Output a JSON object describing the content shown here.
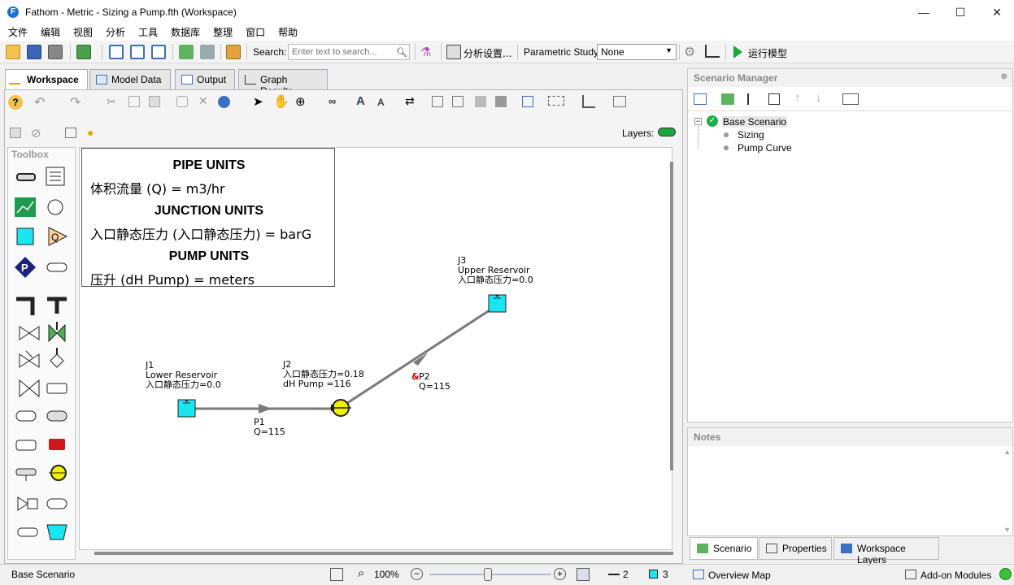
{
  "window": {
    "title": "Fathom - Metric - Sizing a Pump.fth (Workspace)",
    "app_icon_letter": "F",
    "minimize": "—",
    "maximize": "☐",
    "close": "✕"
  },
  "menu": [
    "文件",
    "编辑",
    "视图",
    "分析",
    "工具",
    "数据库",
    "整理",
    "窗口",
    "帮助"
  ],
  "toolbar": {
    "search_label": "Search:",
    "search_placeholder": "Enter text to search...",
    "analysis_settings": "分析设置...",
    "parametric_label": "Parametric Study",
    "parametric_value": "None",
    "run_model": "运行模型"
  },
  "tabs": [
    "Workspace",
    "Model Data",
    "Output",
    "Graph Results"
  ],
  "workspace": {
    "toolbox_title": "Toolbox",
    "layers_label": "Layers:",
    "units": {
      "pipe_head": "PIPE UNITS",
      "pipe_line": "体积流量 (Q) = m3/hr",
      "junction_head": "JUNCTION UNITS",
      "junction_line": "入口静态压力 (入口静态压力) = barG",
      "pump_head": "PUMP UNITS",
      "pump_line": "压升 (dH Pump) = meters"
    },
    "labels": {
      "j1_id": "J1",
      "j1_name": "Lower Reservoir",
      "j1_value": "入口静态压力=0.0",
      "j2_id": "J2",
      "j2_value": "入口静态压力=0.18",
      "j2_dh": "dH Pump =116",
      "j3_id": "J3",
      "j3_name": "Upper Reservoir",
      "j3_value": "入口静态压力=0.0",
      "p1_id": "P1",
      "p1_q": "Q=115",
      "p2_mark": "&",
      "p2_id": "P2",
      "p2_q": "Q=115"
    }
  },
  "statusbar": {
    "scenario": "Base Scenario",
    "zoom": "100%",
    "pipe_count": "2",
    "junction_count": "3"
  },
  "scenario_manager": {
    "title": "Scenario Manager",
    "root": "Base Scenario",
    "children": [
      "Sizing",
      "Pump Curve"
    ]
  },
  "notes": {
    "title": "Notes"
  },
  "bottom_tabs": [
    "Scenario",
    "Properties",
    "Workspace Layers"
  ],
  "bottom_bar": {
    "overview_map": "Overview Map",
    "addon_modules": "Add-on Modules"
  },
  "colors": {
    "accent": "#1e6fd9",
    "reservoir": "#19e6f0",
    "pump": "#f2f200",
    "pipe": "#7a7a7a",
    "run_green": "#18a83a"
  }
}
